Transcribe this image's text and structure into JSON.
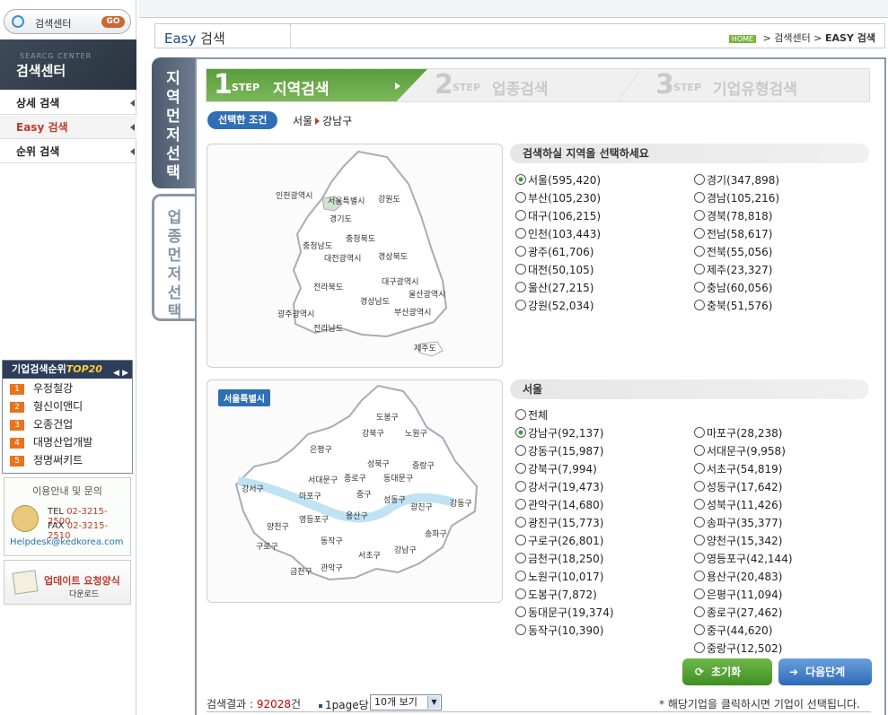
{
  "sidebar": {
    "search_label": "검색센터",
    "go_label": "GO",
    "banner_en": "SEARCG CENTER",
    "banner_ko": "검색센터",
    "menu": [
      {
        "label": "상세 검색",
        "active": false
      },
      {
        "label": "Easy 검색",
        "active": true
      },
      {
        "label": "순위 검색",
        "active": false
      }
    ],
    "top20": {
      "title_prefix": "기업",
      "title_mid": "검색순위",
      "title_suffix": "TOP20",
      "items": [
        {
          "rank": "1",
          "name": "우정철강"
        },
        {
          "rank": "2",
          "name": "형신이앤디"
        },
        {
          "rank": "3",
          "name": "오종건업"
        },
        {
          "rank": "4",
          "name": "대명산업개발"
        },
        {
          "rank": "5",
          "name": "정명써키트"
        }
      ]
    },
    "contact": {
      "title": "이용안내 및 문의",
      "tel_label": "TEL",
      "tel": "02-3215-2500",
      "fax_label": "FAX",
      "fax": "02-3215-2510",
      "email": "Helpdesk@kedkorea.com"
    },
    "update": {
      "line1": "업데이트 요청양식",
      "line2": "다운로드"
    }
  },
  "titlebar": {
    "title_en": "Easy",
    "title_ko": "검색",
    "home": "HOME",
    "crumb1": "검색센터",
    "crumb2": "EASY 검색"
  },
  "vtabs": [
    "지역먼저선택",
    "업종먼저선택"
  ],
  "steps": [
    {
      "num": "1",
      "step": "STEP",
      "label": "지역검색"
    },
    {
      "num": "2",
      "step": "STEP",
      "label": "업종검색"
    },
    {
      "num": "3",
      "step": "STEP",
      "label": "기업유형검색"
    }
  ],
  "condition": {
    "label": "선택한 조건",
    "region": "서울",
    "district": "강남구"
  },
  "region_section": {
    "title": "검색하실 지역을 선택하세요",
    "left": [
      "서울(595,420)",
      "부산(105,230)",
      "대구(106,215)",
      "인천(103,443)",
      "광주(61,706)",
      "대전(50,105)",
      "울산(27,215)",
      "강원(52,034)"
    ],
    "right": [
      "경기(347,898)",
      "경남(105,216)",
      "경북(78,818)",
      "전남(58,617)",
      "전북(55,056)",
      "제주(23,327)",
      "충남(60,056)",
      "충북(51,576)"
    ],
    "selected": "서울(595,420)"
  },
  "korea_map_labels": [
    "인천광역시",
    "서울특별시",
    "강원도",
    "경기도",
    "충청북도",
    "충청남도",
    "대전광역시",
    "경상북도",
    "전라북도",
    "대구광역시",
    "울산광역시",
    "경상남도",
    "광주광역시",
    "부산광역시",
    "전라남도",
    "제주도"
  ],
  "seoul_badge": "서울특별시",
  "seoul_map_labels": [
    "도봉구",
    "강북구",
    "노원구",
    "은평구",
    "성북구",
    "중랑구",
    "서대문구",
    "종로구",
    "동대문구",
    "강서구",
    "마포구",
    "중구",
    "성동구",
    "광진구",
    "강동구",
    "양천구",
    "영등포구",
    "용산구",
    "송파구",
    "구로구",
    "동작구",
    "서초구",
    "강남구",
    "금천구",
    "관악구"
  ],
  "district_section": {
    "title": "서울",
    "all": "전체",
    "left": [
      "강남구(92,137)",
      "강동구(15,987)",
      "강북구(7,994)",
      "강서구(19,473)",
      "관악구(14,680)",
      "광진구(15,773)",
      "구로구(26,801)",
      "금천구(18,250)",
      "노원구(10,017)",
      "도봉구(7,872)",
      "동대문구(19,374)",
      "동작구(10,390)"
    ],
    "right": [
      "마포구(28,238)",
      "서대문구(9,958)",
      "서초구(54,819)",
      "성동구(17,642)",
      "성북구(11,426)",
      "송파구(35,377)",
      "양천구(15,342)",
      "영등포구(42,144)",
      "용산구(20,483)",
      "은평구(11,094)",
      "종로구(27,462)",
      "중구(44,620)",
      "중랑구(12,502)"
    ],
    "selected": "강남구(92,137)"
  },
  "buttons": {
    "reset": "초기화",
    "next": "다음단계"
  },
  "results": {
    "label": "검색결과 :",
    "count": "92028",
    "unit": "건",
    "per_page_label": "1page당",
    "per_page_value": "10개 보기",
    "note": "* 해당기업을 클릭하시면 기업이 선택됩니다."
  }
}
